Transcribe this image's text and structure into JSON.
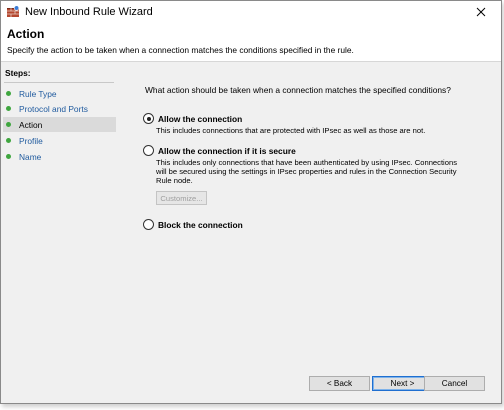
{
  "window": {
    "title": "New Inbound Rule Wizard"
  },
  "header": {
    "title": "Action",
    "description": "Specify the action to be taken when a connection matches the conditions specified in the rule."
  },
  "steps": {
    "heading": "Steps:",
    "items": [
      {
        "label": "Rule Type"
      },
      {
        "label": "Protocol and Ports"
      },
      {
        "label": "Action"
      },
      {
        "label": "Profile"
      },
      {
        "label": "Name"
      }
    ],
    "active_index": 2
  },
  "content": {
    "question": "What action should be taken when a connection matches the specified conditions?",
    "options": [
      {
        "label": "Allow the connection",
        "description": "This includes connections that are protected with IPsec as well as those are not.",
        "selected": true
      },
      {
        "label": "Allow the connection if it is secure",
        "description": "This includes only connections that have been authenticated by using IPsec.  Connections will be secured using the settings in IPsec properties and rules in the Connection Security Rule node.",
        "selected": false
      },
      {
        "label": "Block the connection",
        "selected": false
      }
    ],
    "customize_label": "Customize..."
  },
  "buttons": {
    "back": "< Back",
    "next": "Next >",
    "cancel": "Cancel"
  },
  "colors": {
    "step_link": "#1f5a9e",
    "step_dot": "#3fa63f",
    "active_step_bg": "#dadada",
    "default_button_border": "#1f6fd0"
  }
}
